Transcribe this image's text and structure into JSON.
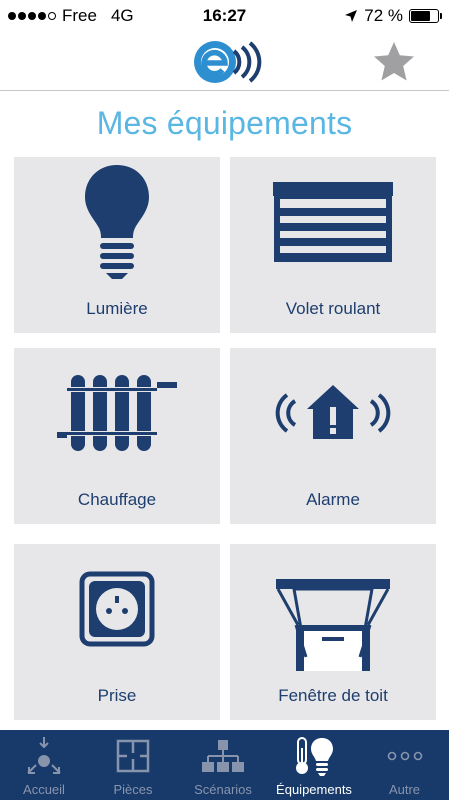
{
  "status_bar": {
    "carrier": "Free",
    "network": "4G",
    "time": "16:27",
    "battery": "72 %",
    "battery_level": 0.72
  },
  "header": {
    "logo": "e-wave-logo",
    "favorite_icon": "star-icon"
  },
  "page_title": "Mes équipements",
  "tiles": [
    {
      "label": "Lumière",
      "icon": "light-bulb-icon"
    },
    {
      "label": "Volet roulant",
      "icon": "roller-shutter-icon"
    },
    {
      "label": "Chauffage",
      "icon": "radiator-icon"
    },
    {
      "label": "Alarme",
      "icon": "alarm-house-icon"
    },
    {
      "label": "Prise",
      "icon": "power-outlet-icon"
    },
    {
      "label": "Fenêtre de toit",
      "icon": "roof-window-icon"
    }
  ],
  "tabbar": [
    {
      "label": "Accueil",
      "icon": "home-arrows-icon"
    },
    {
      "label": "Pièces",
      "icon": "rooms-icon"
    },
    {
      "label": "Scénarios",
      "icon": "scenarios-icon"
    },
    {
      "label": "Équipements",
      "icon": "equipment-icon",
      "active": true
    },
    {
      "label": "Autre",
      "icon": "more-icon"
    }
  ],
  "colors": {
    "accent": "#5ab6e2",
    "navy": "#1d3e6e",
    "tabbar": "#173a6a",
    "tile_bg": "#e7e7e9"
  }
}
